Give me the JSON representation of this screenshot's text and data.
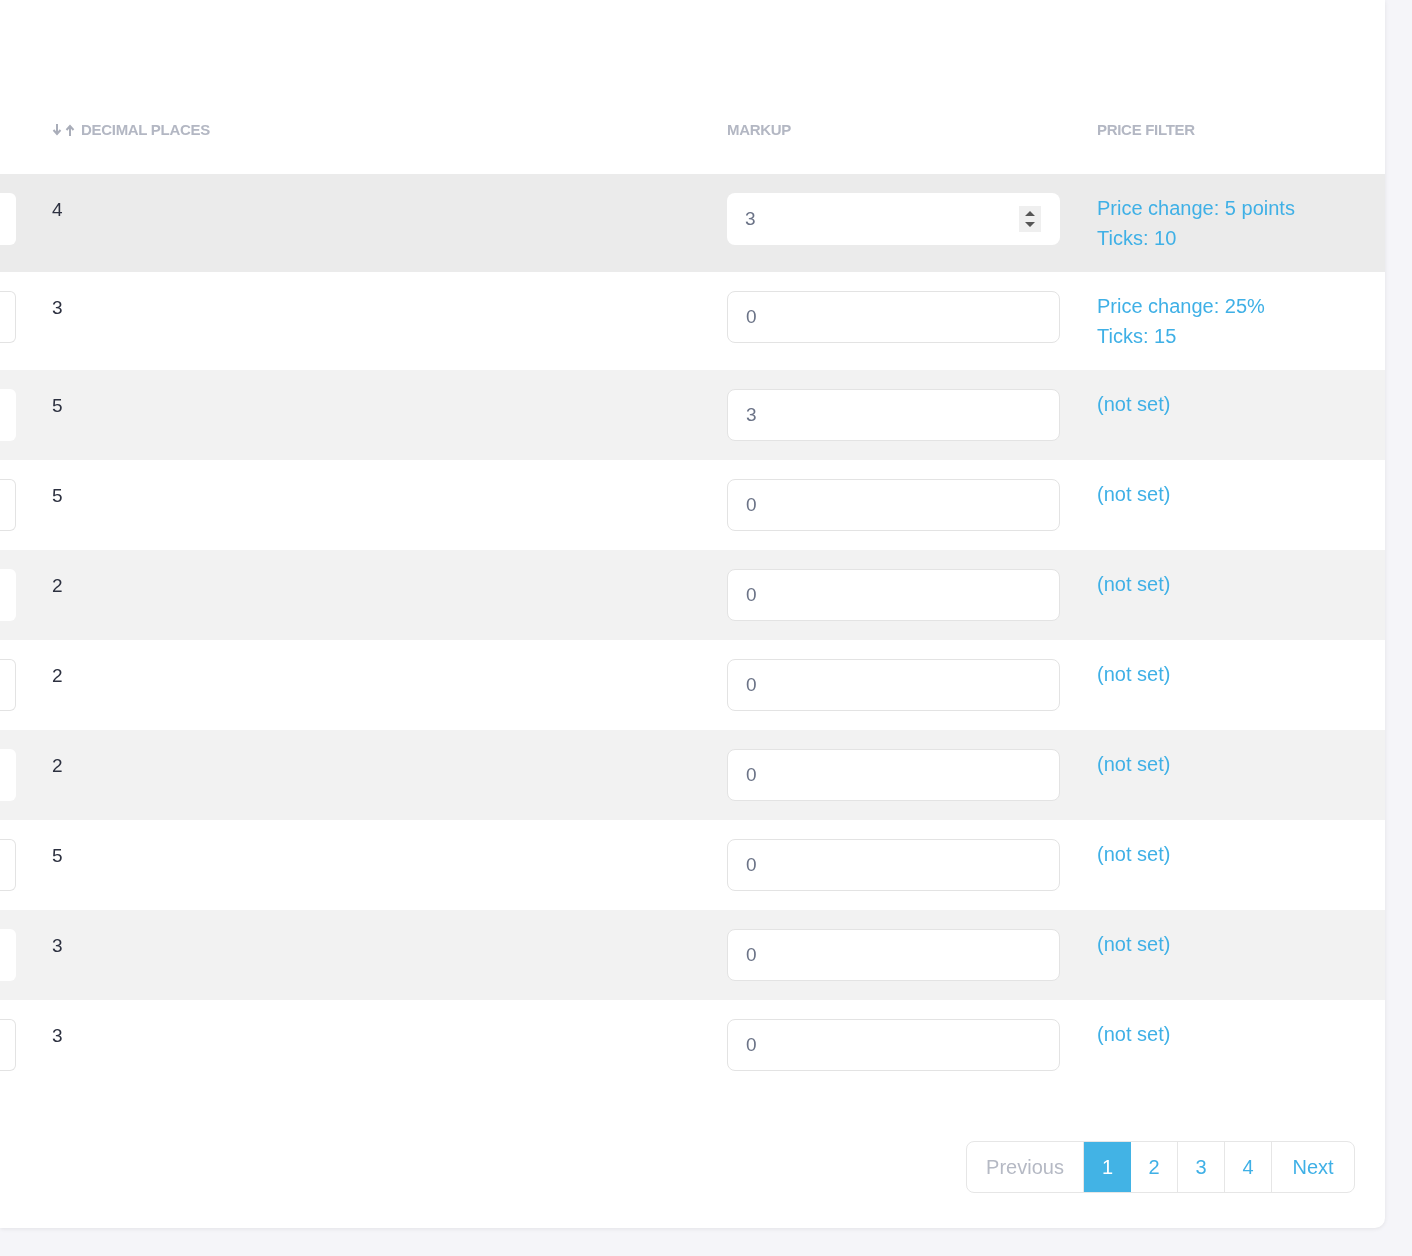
{
  "table": {
    "columns": [
      {
        "label": "DECIMAL PLACES",
        "sortable": true
      },
      {
        "label": "MARKUP",
        "sortable": false
      },
      {
        "label": "PRICE FILTER",
        "sortable": false
      }
    ],
    "rows": [
      {
        "decimal_places": "4",
        "markup": "3",
        "hovered": true,
        "price_filter": [
          "Price change: 5 points",
          "Ticks: 10"
        ]
      },
      {
        "decimal_places": "3",
        "markup": "0",
        "hovered": false,
        "price_filter": [
          "Price change: 25%",
          "Ticks: 15"
        ]
      },
      {
        "decimal_places": "5",
        "markup": "3",
        "hovered": false,
        "price_filter": [
          "(not set)"
        ]
      },
      {
        "decimal_places": "5",
        "markup": "0",
        "hovered": false,
        "price_filter": [
          "(not set)"
        ]
      },
      {
        "decimal_places": "2",
        "markup": "0",
        "hovered": false,
        "price_filter": [
          "(not set)"
        ]
      },
      {
        "decimal_places": "2",
        "markup": "0",
        "hovered": false,
        "price_filter": [
          "(not set)"
        ]
      },
      {
        "decimal_places": "2",
        "markup": "0",
        "hovered": false,
        "price_filter": [
          "(not set)"
        ]
      },
      {
        "decimal_places": "5",
        "markup": "0",
        "hovered": false,
        "price_filter": [
          "(not set)"
        ]
      },
      {
        "decimal_places": "3",
        "markup": "0",
        "hovered": false,
        "price_filter": [
          "(not set)"
        ]
      },
      {
        "decimal_places": "3",
        "markup": "0",
        "hovered": false,
        "price_filter": [
          "(not set)"
        ]
      }
    ]
  },
  "pagination": {
    "previous": {
      "label": "Previous",
      "disabled": true
    },
    "pages": [
      {
        "label": "1",
        "selected": true
      },
      {
        "label": "2",
        "selected": false
      },
      {
        "label": "3",
        "selected": false
      },
      {
        "label": "4",
        "selected": false
      }
    ],
    "next": {
      "label": "Next",
      "disabled": false
    }
  }
}
